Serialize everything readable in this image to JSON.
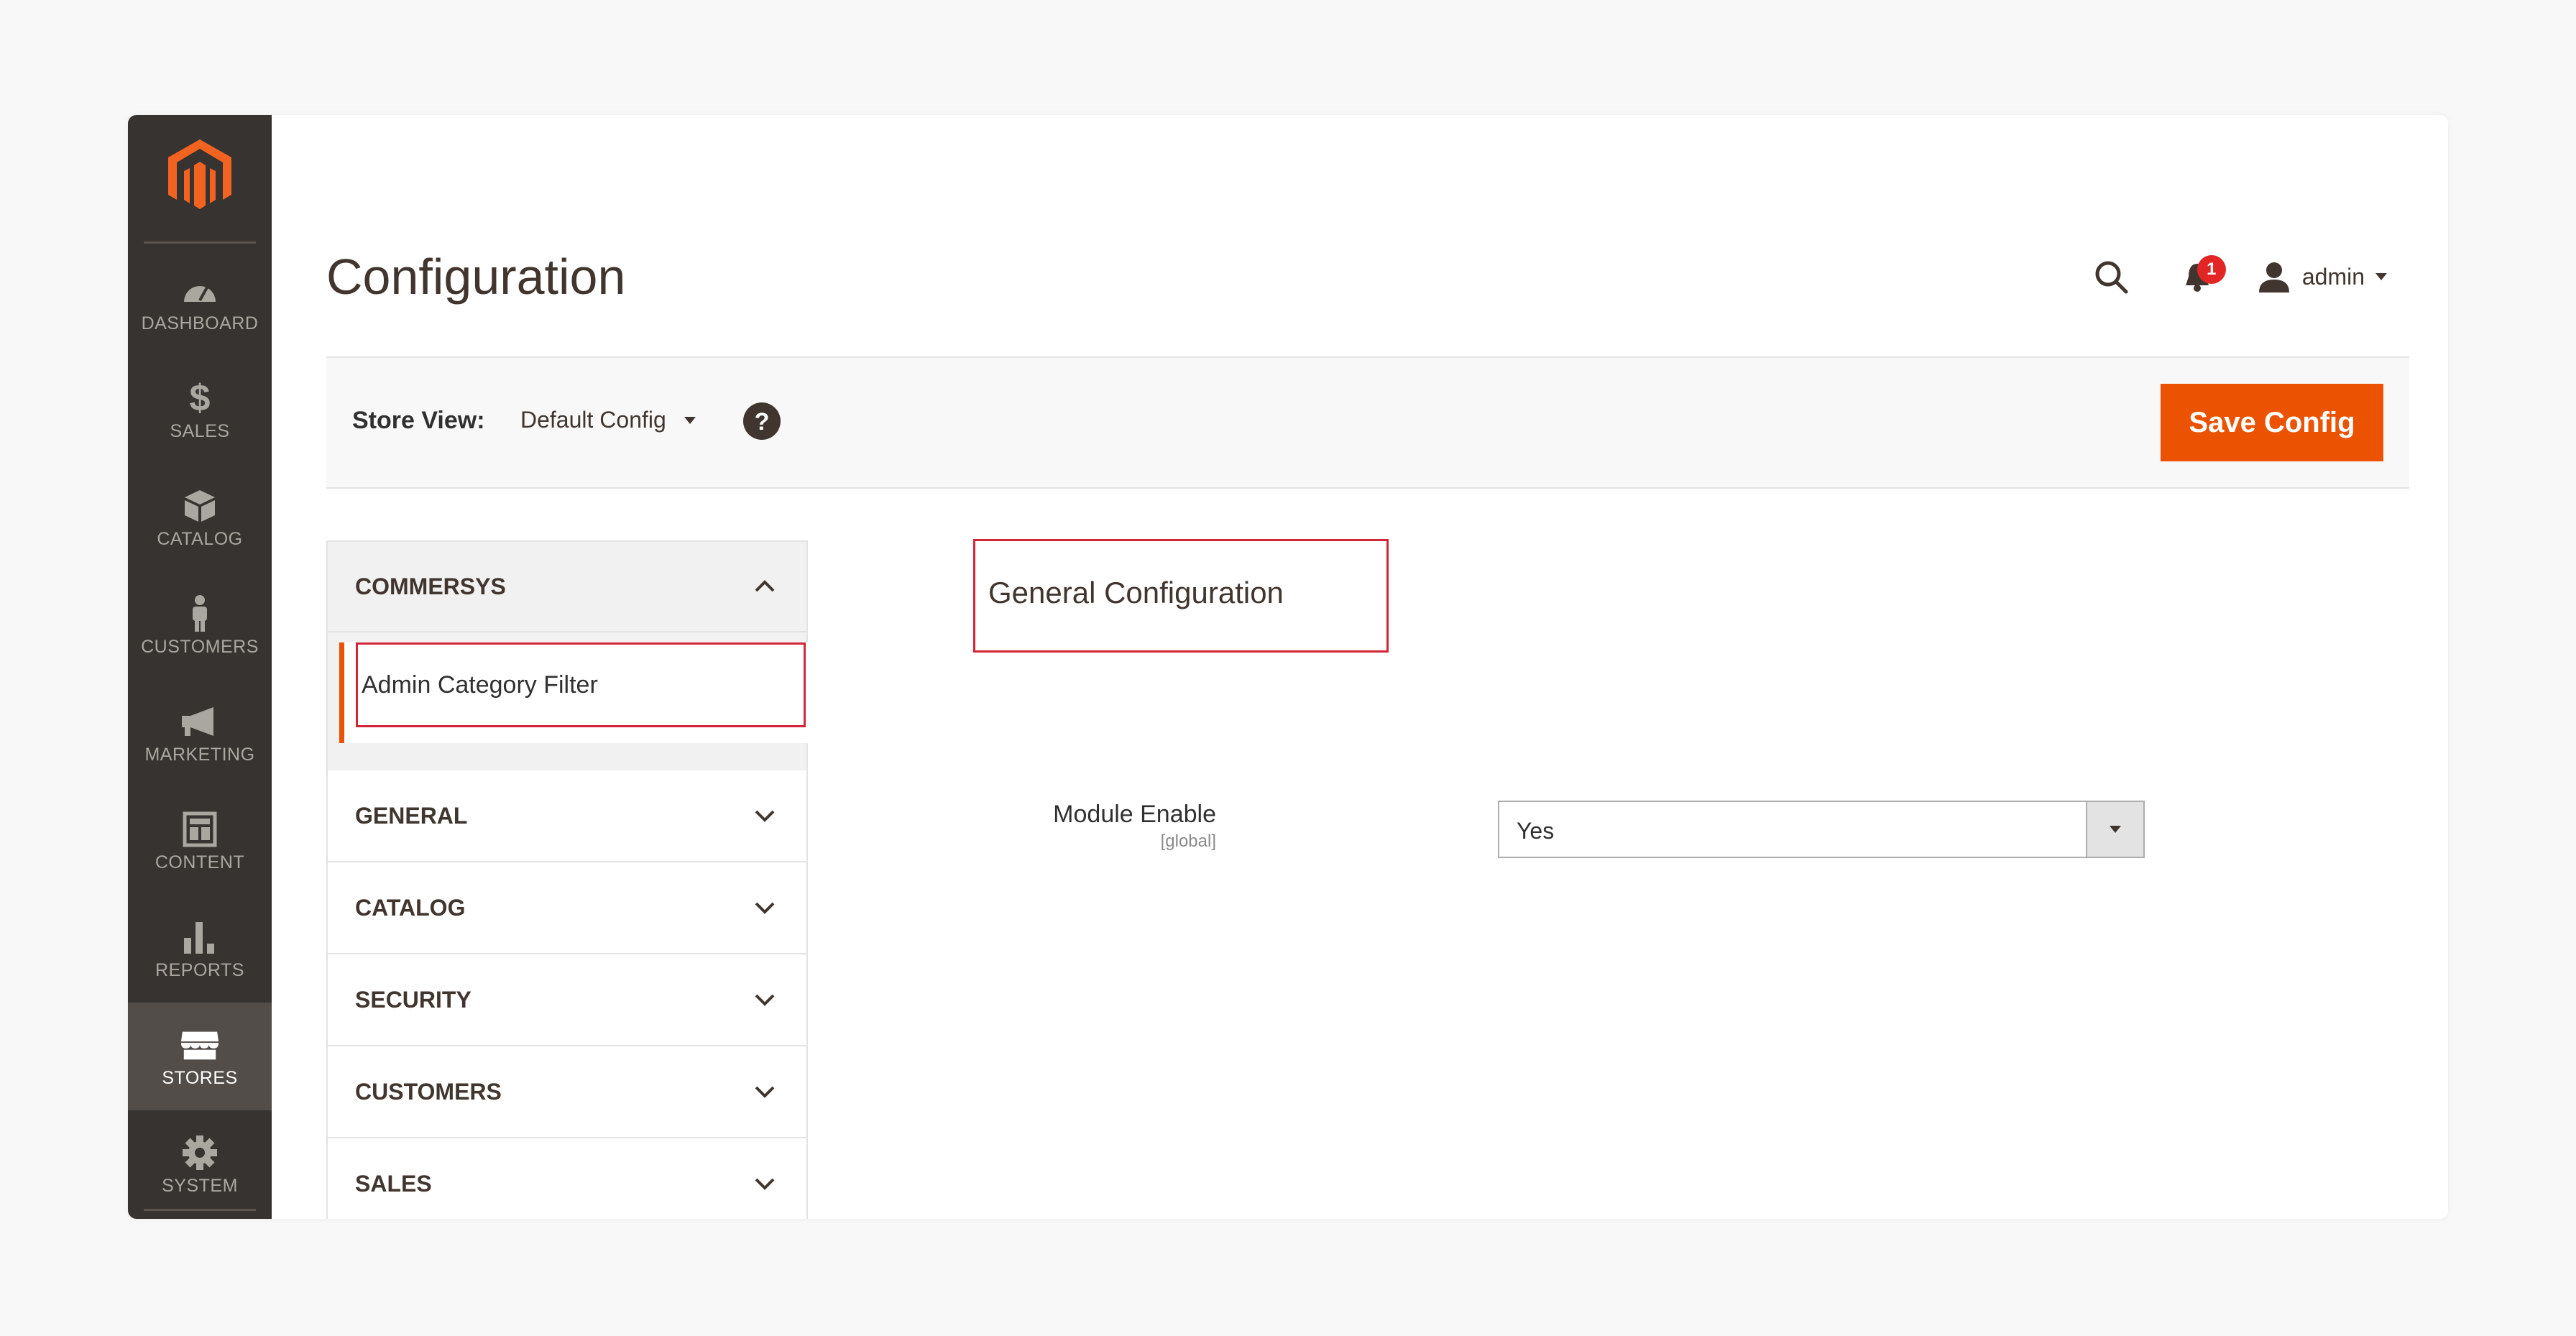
{
  "sidebar": {
    "logo": "magento-logo",
    "items": [
      {
        "label": "DASHBOARD",
        "icon": "dashboard-icon"
      },
      {
        "label": "SALES",
        "icon": "dollar-icon"
      },
      {
        "label": "CATALOG",
        "icon": "box-icon"
      },
      {
        "label": "CUSTOMERS",
        "icon": "person-icon"
      },
      {
        "label": "MARKETING",
        "icon": "megaphone-icon"
      },
      {
        "label": "CONTENT",
        "icon": "layout-icon"
      },
      {
        "label": "REPORTS",
        "icon": "bar-chart-icon"
      },
      {
        "label": "STORES",
        "icon": "store-icon",
        "active": true
      },
      {
        "label": "SYSTEM",
        "icon": "gear-icon"
      }
    ]
  },
  "header": {
    "title": "Configuration",
    "notification_count": "1",
    "user_name": "admin"
  },
  "storebar": {
    "label": "Store View:",
    "scope": "Default Config",
    "save_label": "Save Config"
  },
  "tabs": {
    "open_group": "COMMERSYS",
    "open_item": "Admin Category Filter",
    "groups": [
      "GENERAL",
      "CATALOG",
      "SECURITY",
      "CUSTOMERS",
      "SALES"
    ]
  },
  "section": {
    "title": "General Configuration",
    "field_label": "Module Enable",
    "field_scope": "[global]",
    "field_value": "Yes"
  },
  "colors": {
    "accent": "#eb5202",
    "sidebar_bg": "#373330",
    "highlight_border": "#d3253a",
    "badge": "#e22626"
  }
}
